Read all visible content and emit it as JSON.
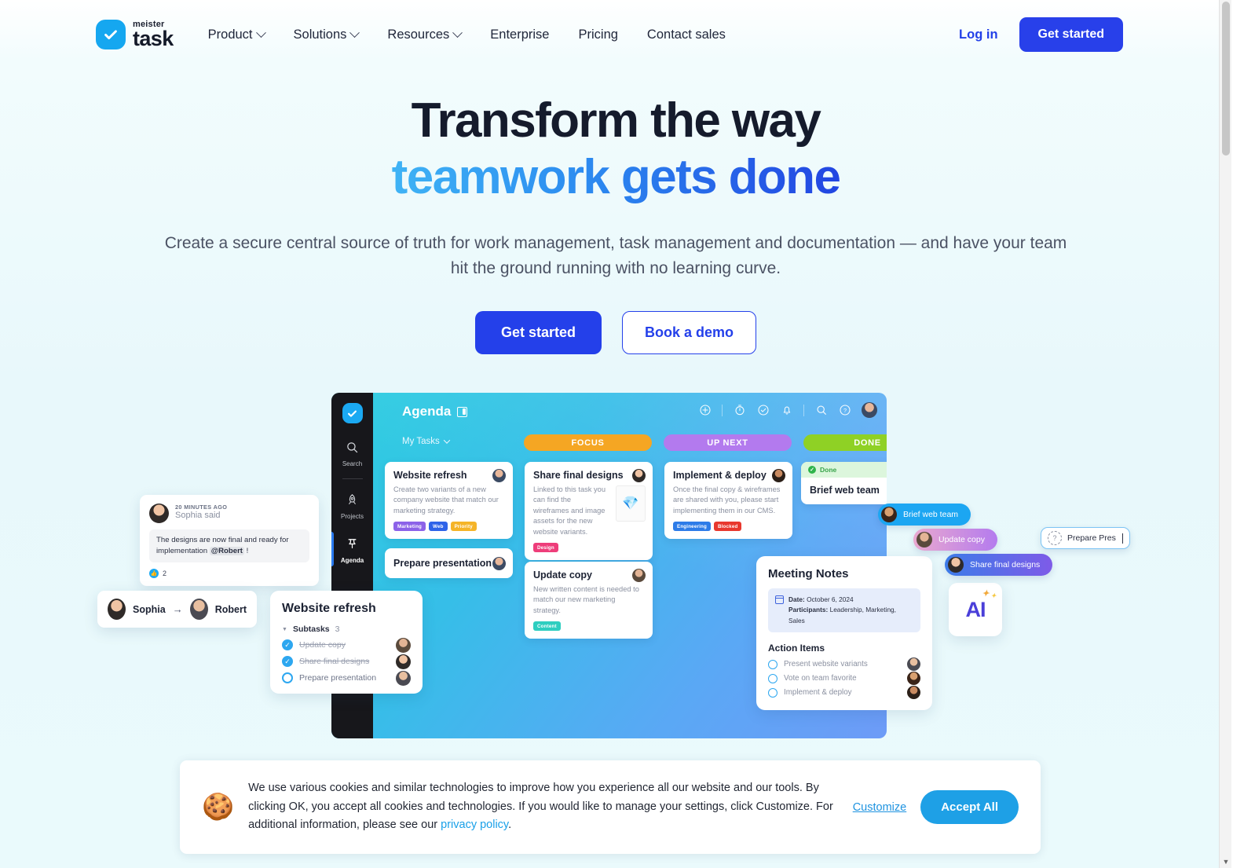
{
  "brand": {
    "name_top": "meister",
    "name_bottom": "task",
    "accent_blue": "#2440ea",
    "logo_blue": "#15A7F0"
  },
  "nav": {
    "links": [
      {
        "label": "Product",
        "has_caret": true
      },
      {
        "label": "Solutions",
        "has_caret": true
      },
      {
        "label": "Resources",
        "has_caret": true
      },
      {
        "label": "Enterprise",
        "has_caret": false
      },
      {
        "label": "Pricing",
        "has_caret": false
      },
      {
        "label": "Contact sales",
        "has_caret": false
      }
    ],
    "login_label": "Log in",
    "get_started_label": "Get started"
  },
  "hero": {
    "title_line1": "Transform the way",
    "title_line2": "teamwork gets done",
    "subtitle": "Create a secure central source of truth for work management, task management and documentation — and have your team hit the ground running with no learning curve.",
    "cta_primary": "Get started",
    "cta_secondary": "Book a demo"
  },
  "app": {
    "title": "Agenda",
    "sidebar": [
      {
        "label": "Search",
        "icon": "search-icon",
        "active": false
      },
      {
        "label": "Projects",
        "icon": "rocket-icon",
        "active": false
      },
      {
        "label": "Agenda",
        "icon": "pin-icon",
        "active": true
      }
    ],
    "header_icons": [
      "plus-icon",
      "timer-icon",
      "check-circle-icon",
      "bell-icon",
      "search-icon",
      "help-icon"
    ],
    "filter_label": "My Tasks",
    "columns": [
      {
        "label": "FOCUS",
        "color": "#F5A623"
      },
      {
        "label": "UP NEXT",
        "color": "#B37AEE"
      },
      {
        "label": "DONE",
        "color": "#8FD125"
      }
    ],
    "cards": {
      "website_refresh": {
        "title": "Website refresh",
        "desc": "Create two variants of a new company website that match our marketing strategy.",
        "tags": [
          {
            "label": "Marketing",
            "color": "#8C62E8"
          },
          {
            "label": "Web",
            "color": "#2E63E8"
          },
          {
            "label": "Priority",
            "color": "#F5B428"
          }
        ]
      },
      "prepare_presentation": {
        "title": "Prepare presentation"
      },
      "share_final_designs": {
        "title": "Share final designs",
        "desc": "Linked to this task you can find the wireframes and image assets for the new website variants.",
        "tags": [
          {
            "label": "Design",
            "color": "#EE3D7A"
          }
        ],
        "attachment_icon": "sketch-file-icon"
      },
      "update_copy": {
        "title": "Update copy",
        "desc": "New written content is needed to match our new marketing strategy.",
        "tags": [
          {
            "label": "Content",
            "color": "#2ECEC0"
          }
        ]
      },
      "implement_deploy": {
        "title": "Implement & deploy",
        "desc": "Once the final copy & wireframes are shared with you, please start implementing them in our CMS.",
        "tags": [
          {
            "label": "Engineering",
            "color": "#2E7CE8"
          },
          {
            "label": "Blocked",
            "color": "#E8382E"
          }
        ]
      },
      "brief_web_team": {
        "status": "Done",
        "title": "Brief web team"
      }
    }
  },
  "comment": {
    "timestamp": "20 MINUTES AGO",
    "author": "Sophia",
    "said_label": "said",
    "text_before": "The designs are now final and ready for implementation ",
    "mention": "@Robert",
    "text_after": " !",
    "like_count": "2"
  },
  "assignment": {
    "from": "Sophia",
    "arrow": "→",
    "to": "Robert"
  },
  "subtasks_card": {
    "title": "Website refresh",
    "section_label": "Subtasks",
    "count": "3",
    "items": [
      {
        "label": "Update copy",
        "done": true
      },
      {
        "label": "Share final designs",
        "done": true
      },
      {
        "label": "Prepare presentation",
        "done": false
      }
    ]
  },
  "meeting_notes": {
    "title": "Meeting Notes",
    "date_label": "Date:",
    "date_value": "October 6, 2024",
    "participants_label": "Participants:",
    "participants_value": "Leadership, Marketing, Sales",
    "action_items_label": "Action Items",
    "action_items": [
      "Present website variants",
      "Vote on team favorite",
      "Implement & deploy"
    ]
  },
  "pills": [
    {
      "label": "Brief web team"
    },
    {
      "label": "Update copy"
    },
    {
      "label": "Share final designs"
    }
  ],
  "pill_input": {
    "value": "Prepare Pres",
    "avatar_glyph": "?"
  },
  "ai_card": {
    "label": "AI"
  },
  "cookie": {
    "icon": "cookie-icon",
    "text_part1": "We use various cookies and similar technologies to improve how you experience all our website and our tools. By clicking OK, you accept all cookies and technologies. If you would like to manage your settings, click Customize. For additional information, please see our ",
    "privacy_link": "privacy policy",
    "text_part2": ".",
    "customize_label": "Customize",
    "accept_label": "Accept All"
  }
}
